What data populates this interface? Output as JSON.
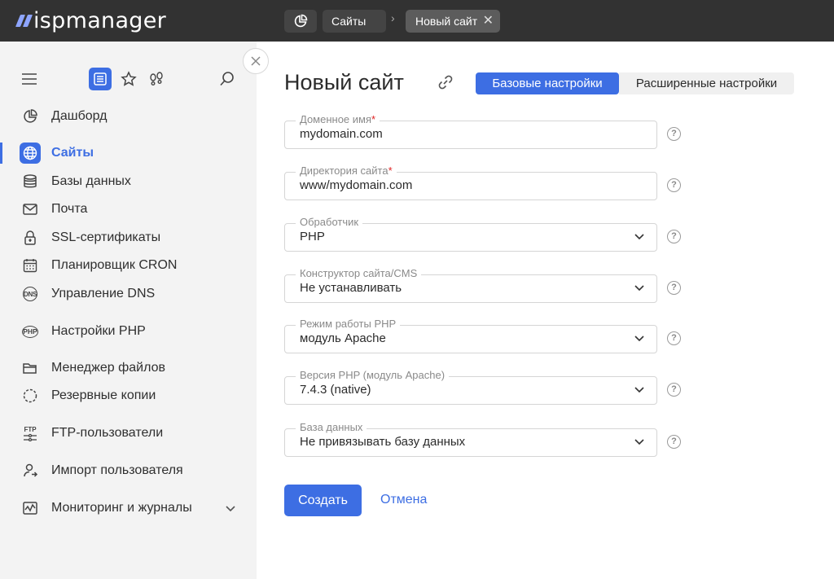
{
  "app": {
    "logo_text": "ispmanager"
  },
  "topbar": {
    "dashboard_icon": "pie-chart-icon",
    "breadcrumb": "Сайты",
    "separator": "›",
    "active_tab": "Новый сайт",
    "close_symbol": "✕"
  },
  "sidebar": {
    "tools": [
      "menu-icon",
      "list-icon",
      "star-icon",
      "footprints-icon",
      "search-icon"
    ],
    "items": [
      {
        "label": "Дашборд",
        "icon": "pie-chart-icon"
      },
      {
        "label": "Сайты",
        "icon": "globe-icon",
        "active": true
      },
      {
        "label": "Базы данных",
        "icon": "database-icon"
      },
      {
        "label": "Почта",
        "icon": "mail-icon"
      },
      {
        "label": "SSL-сертификаты",
        "icon": "lock-icon"
      },
      {
        "label": "Планировщик CRON",
        "icon": "calendar-icon"
      },
      {
        "label": "Управление DNS",
        "icon": "dns-icon"
      },
      {
        "label": "Настройки PHP",
        "icon": "php-icon"
      },
      {
        "label": "Менеджер файлов",
        "icon": "folder-icon"
      },
      {
        "label": "Резервные копии",
        "icon": "backup-icon"
      },
      {
        "label": "FTP-пользователи",
        "icon": "ftp-icon"
      },
      {
        "label": "Импорт пользователя",
        "icon": "user-import-icon"
      },
      {
        "label": "Мониторинг и журналы",
        "icon": "monitoring-icon"
      }
    ],
    "dns_glyph": "DNS",
    "php_glyph": "PHP",
    "ftp_glyph": "FTP"
  },
  "main": {
    "title": "Новый сайт",
    "tabs": {
      "basic": "Базовые настройки",
      "advanced": "Расширенные настройки"
    },
    "fields": [
      {
        "label": "Доменное имя",
        "required": true,
        "value": "mydomain.com",
        "type": "input"
      },
      {
        "label": "Директория сайта",
        "required": true,
        "value": "www/mydomain.com",
        "type": "input"
      },
      {
        "label": "Обработчик",
        "value": "PHP",
        "type": "select"
      },
      {
        "label": "Конструктор сайта/CMS",
        "value": "Не устанавливать",
        "type": "select"
      },
      {
        "label": "Режим работы PHP",
        "value": "модуль Apache",
        "type": "select"
      },
      {
        "label": "Версия PHP (модуль Apache)",
        "value": "7.4.3 (native)",
        "type": "select"
      },
      {
        "label": "База данных",
        "value": "Не привязывать базу данных",
        "type": "select"
      }
    ],
    "required_mark": "*",
    "help_symbol": "?",
    "submit": "Создать",
    "cancel": "Отмена"
  },
  "colors": {
    "accent": "#3d6ee3",
    "topbar": "#323232",
    "sidebar_bg": "#f3f3f3"
  }
}
